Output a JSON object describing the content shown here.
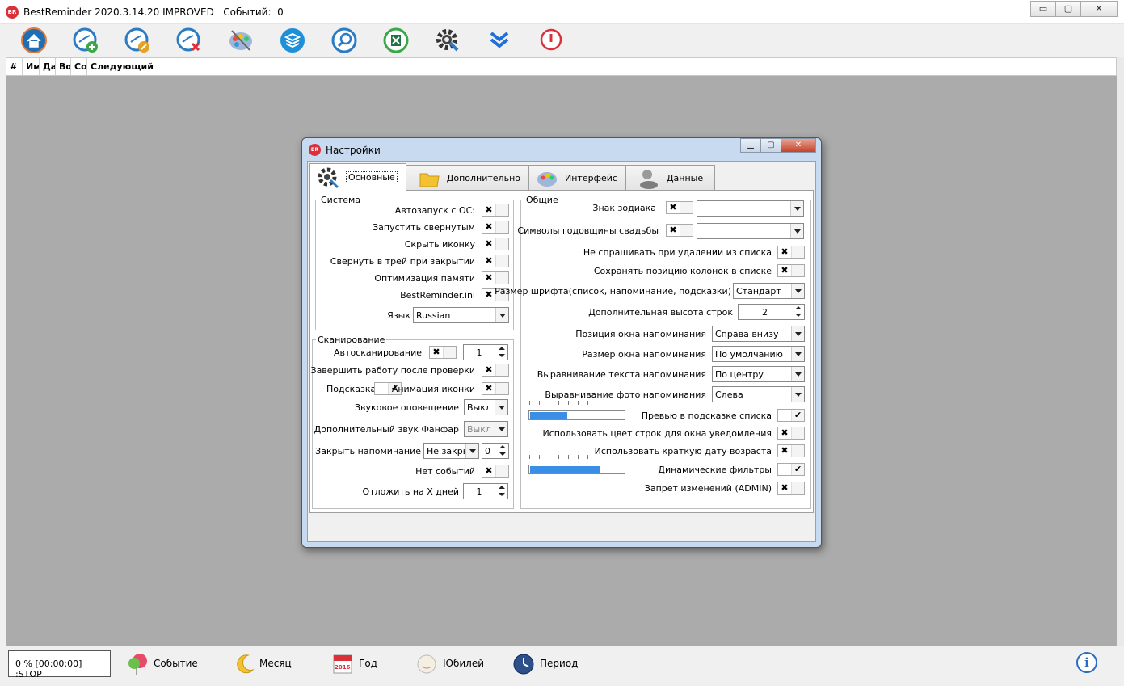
{
  "window": {
    "logo": "BR",
    "title": "BestReminder 2020.3.14.20 IMPROVED   Событий:  0",
    "minimize": "▭",
    "maximize": "▢",
    "close": "✕"
  },
  "toolbar": {
    "buttons": [
      "home-icon",
      "add-event-icon",
      "edit-event-icon",
      "delete-event-icon",
      "palette-icon",
      "layers-icon",
      "search-icon",
      "excel-icon",
      "settings-icon",
      "chevron-down-icon",
      "power-icon"
    ]
  },
  "list": {
    "columns": [
      "#",
      "Им",
      "Да",
      "Во",
      "Со",
      "Следующий"
    ]
  },
  "status": {
    "progress": "0 % [00:00:00] :STOP",
    "items": [
      "Событие",
      "Месяц",
      "Год",
      "Юбилей",
      "Период"
    ],
    "year_badge": "2016",
    "info": "i"
  },
  "dialog": {
    "logo": "BR",
    "title": "Настройки",
    "tabs": [
      "Основные",
      "Дополнительно",
      "Интерфейс",
      "Данные"
    ],
    "system": {
      "legend": "Система",
      "rows": [
        {
          "label": "Автозапуск с ОС:",
          "checked": true
        },
        {
          "label": "Запустить свернутым",
          "checked": true
        },
        {
          "label": "Скрыть иконку",
          "checked": true
        },
        {
          "label": "Свернуть в трей при закрытии",
          "checked": true
        },
        {
          "label": "Оптимизация памяти",
          "checked": true
        },
        {
          "label": "BestReminder.ini",
          "checked": true
        }
      ],
      "language_label": "Язык",
      "language_value": "Russian"
    },
    "scan": {
      "legend": "Сканирование",
      "autoscan_label": "Автосканирование",
      "autoscan_value": "1",
      "finish_label": "Завершить работу после проверки",
      "hint_label": "Подсказка",
      "anim_label": "Анимация иконки",
      "sound_label": "Звуковое оповещение",
      "sound_value": "Выкл",
      "fanfare_label": "Дополнительный звук Фанфар",
      "fanfare_value": "Выкл",
      "close_label": "Закрыть напоминание",
      "close_value": "Не закры",
      "close_num": "0",
      "noevents_label": "Нет событий",
      "postpone_label": "Отложить на X дней",
      "postpone_value": "1"
    },
    "general": {
      "legend": "Общие",
      "zodiac_label": "Знак зодиака",
      "wedding_label": "Символы годовщины свадьбы",
      "noask_label": "Не спрашивать при удалении из списка",
      "savecols_label": "Сохранять позицию колонок в списке",
      "fontsize_label": "Размер шрифта(список, напоминание, подсказки)",
      "fontsize_value": "Стандарт",
      "rowheight_label": "Дополнительная высота строк",
      "rowheight_value": "2",
      "winpos_label": "Позиция окна напоминания",
      "winpos_value": "Справа внизу",
      "winsize_label": "Размер окна напоминания",
      "winsize_value": "По умолчанию",
      "textalign_label": "Выравнивание текста напоминания",
      "textalign_value": "По центру",
      "photoalign_label": "Выравнивание фото напоминания",
      "photoalign_value": "Слева",
      "preview_label": "Превью в подсказке списка",
      "preview_slider": 0.4,
      "rowcolor_label": "Использовать цвет строк для окна уведомления",
      "shortdate_label": "Использовать краткую дату возраста",
      "dynfilter_label": "Динамические фильтры",
      "dynfilter_slider": 0.75,
      "admin_label": "Запрет изменений (ADMIN)"
    },
    "marks": {
      "cross": "✖",
      "check": "✔"
    }
  },
  "colors": {
    "accent_blue": "#3a8ee6",
    "logo_red": "#d9303a"
  }
}
